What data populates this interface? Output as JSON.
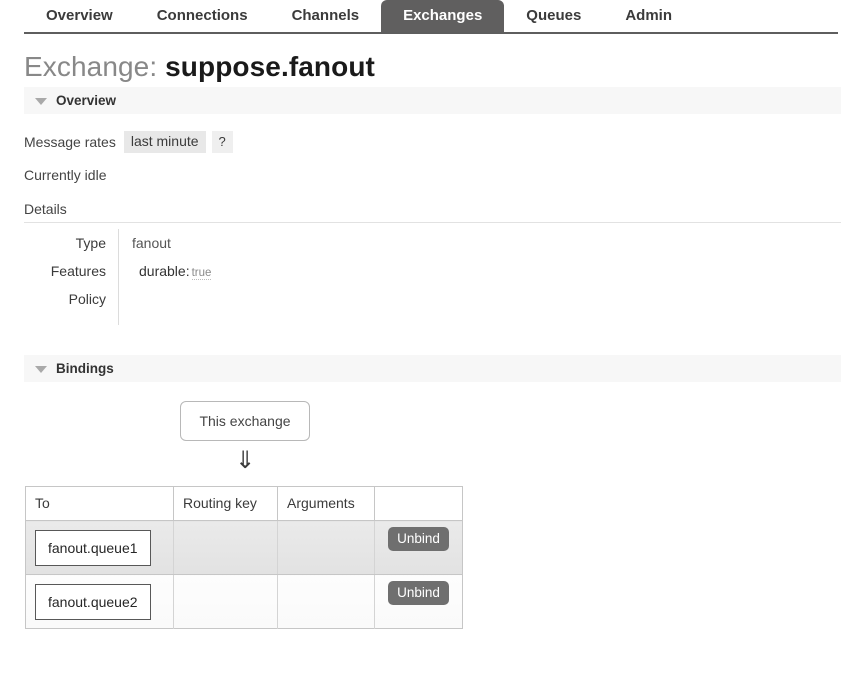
{
  "nav": {
    "tabs": [
      {
        "label": "Overview",
        "active": false
      },
      {
        "label": "Connections",
        "active": false
      },
      {
        "label": "Channels",
        "active": false
      },
      {
        "label": "Exchanges",
        "active": true
      },
      {
        "label": "Queues",
        "active": false
      },
      {
        "label": "Admin",
        "active": false
      }
    ]
  },
  "page": {
    "title_prefix": "Exchange:",
    "object_name": "suppose.fanout"
  },
  "overview": {
    "section_label": "Overview",
    "toggle_icon": "triangle-down-icon",
    "message_rates_label": "Message rates",
    "message_rates_period": "last minute",
    "help_label": "?",
    "status_text": "Currently idle",
    "details_label": "Details",
    "details": [
      {
        "key": "Type",
        "value": "fanout"
      },
      {
        "key": "Features",
        "feature_name": "durable:",
        "feature_value": "true"
      },
      {
        "key": "Policy",
        "value": ""
      }
    ]
  },
  "bindings": {
    "section_label": "Bindings",
    "toggle_icon": "triangle-down-icon",
    "this_exchange_label": "This exchange",
    "arrow_glyph": "⇓",
    "arrow_icon": "double-arrow-down-icon",
    "columns": [
      "To",
      "Routing key",
      "Arguments",
      ""
    ],
    "rows": [
      {
        "to": "fanout.queue1",
        "routing_key": "",
        "arguments": "",
        "action_label": "Unbind"
      },
      {
        "to": "fanout.queue2",
        "routing_key": "",
        "arguments": "",
        "action_label": "Unbind"
      }
    ]
  },
  "colors": {
    "active_tab_bg": "#605f5f",
    "nav_rule": "#5e5e5e",
    "section_head_bg": "#f7f7f7",
    "chip_bg": "#e8e8e8",
    "unbind_bg": "#6f6f6f",
    "row_odd_bg": "#e5e5e5",
    "row_even_bg": "#fcfcfc",
    "title_prefix_color": "#888888",
    "object_name_color": "#1a1a1a"
  }
}
